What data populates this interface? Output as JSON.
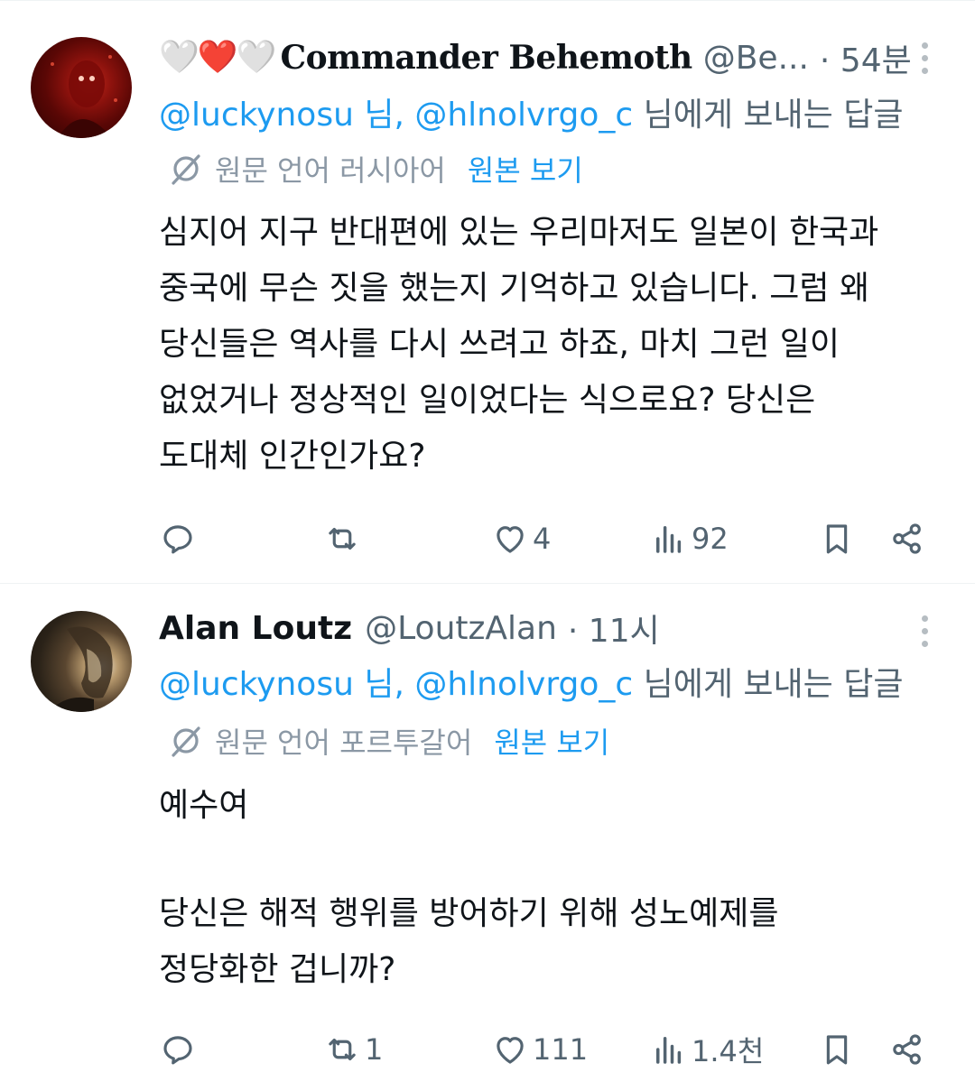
{
  "tweets": [
    {
      "author_name": "Commander Behemoth",
      "author_hearts": [
        "🤍",
        "❤️",
        "🤍"
      ],
      "handle": "@Be...",
      "time": "· 54분",
      "reply_link_1": "@luckynosu 님,",
      "reply_link_2": "@hlnolvrgo_c",
      "reply_suffix": "님에게 보내는 답글",
      "translate_lang": "원문 언어 러시아어",
      "translate_action": "원본 보기",
      "body_lines": [
        "심지어 지구 반대편에 있는 우리마저도 일본이 한국과",
        "중국에 무슨 짓을 했는지 기억하고 있습니다. 그럼 왜",
        "당신들은 역사를 다시 쓰려고 하죠, 마치 그런 일이",
        "없었거나 정상적인 일이었다는 식으로요? 당신은",
        "도대체 인간인가요?"
      ],
      "replies": "",
      "retweets": "",
      "likes": "4",
      "views": "92"
    },
    {
      "author_name": "Alan Loutz",
      "handle": "@LoutzAlan",
      "time": "· 11시",
      "reply_link_1": "@luckynosu 님,",
      "reply_link_2": "@hlnolvrgo_c",
      "reply_suffix": "님에게 보내는 답글",
      "translate_lang": "원문 언어 포르투갈어",
      "translate_action": "원본 보기",
      "body_lines": [
        "예수여",
        "",
        "당신은 해적 행위를 방어하기 위해 성노예제를",
        "정당화한 겁니까?"
      ],
      "replies": "",
      "retweets": "1",
      "likes": "111",
      "views": "1.4천"
    }
  ],
  "colors": {
    "link": "#1d9bf0",
    "secondary_text": "#536471",
    "primary_text": "#0f1419",
    "divider": "#eff3f4"
  }
}
